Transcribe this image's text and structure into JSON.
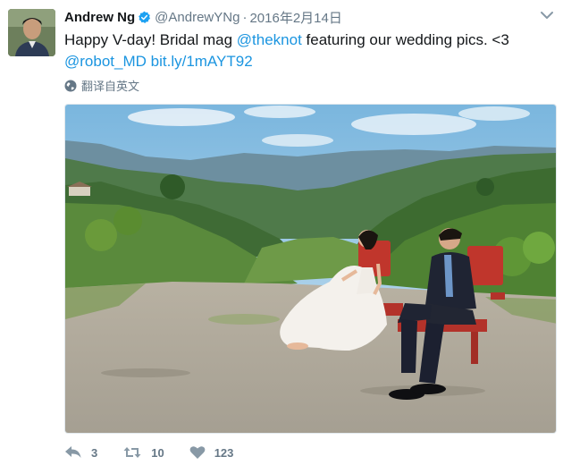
{
  "author": {
    "name": "Andrew Ng",
    "handle": "@AndrewYNg",
    "separator": "·",
    "date": "2016年2月14日"
  },
  "tweet": {
    "text_part1": "Happy V-day! Bridal mag ",
    "mention_1": "@theknot",
    "text_part2": " featuring our wedding pics. <3",
    "mention_2": "@robot_MD",
    "link": "bit.ly/1mAYT92"
  },
  "translate_label": "翻译自英文",
  "actions": {
    "reply_count": "3",
    "retweet_count": "10",
    "like_count": "123"
  },
  "colors": {
    "link": "#1b95e0",
    "verified": "#1da1f2",
    "muted": "#657786"
  },
  "icons": [
    "verified-icon",
    "chevron-down-icon",
    "globe-icon",
    "reply-icon",
    "retweet-icon",
    "heart-icon"
  ]
}
